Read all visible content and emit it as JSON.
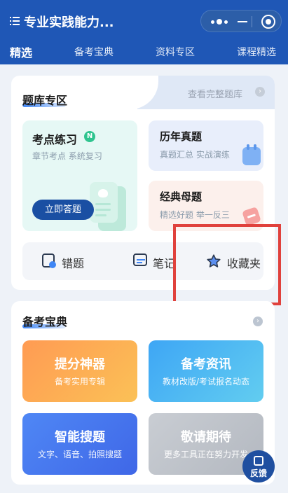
{
  "header": {
    "title": "专业实践能力...",
    "tabs": [
      "精选",
      "备考宝典",
      "资料专区",
      "课程精选"
    ]
  },
  "question_bank": {
    "title": "题库专区",
    "view_all": "查看完整题库",
    "practice": {
      "title": "考点练习",
      "badge": "N",
      "subtitle": "章节考点 系统复习",
      "button": "立即答题"
    },
    "past_exams": {
      "title": "历年真题",
      "subtitle": "真题汇总 实战演练"
    },
    "classic": {
      "title": "经典母题",
      "subtitle": "精选好题 举一反三"
    },
    "tools": [
      {
        "label": "错题",
        "icon": "wrong-book-icon"
      },
      {
        "label": "笔记",
        "icon": "notes-icon"
      },
      {
        "label": "收藏夹",
        "icon": "star-icon"
      }
    ]
  },
  "guide": {
    "title": "备考宝典",
    "items": [
      {
        "title": "提分神器",
        "subtitle": "备考实用专辑"
      },
      {
        "title": "备考资讯",
        "subtitle": "教材改版/考试报名动态"
      },
      {
        "title": "智能搜题",
        "subtitle": "文字、语音、拍照搜题"
      },
      {
        "title": "敬请期待",
        "subtitle": "更多工具正在努力开发"
      }
    ]
  },
  "feedback": {
    "label": "反馈"
  },
  "colors": {
    "brand": "#1f57b6",
    "highlight": "#e0413c"
  }
}
